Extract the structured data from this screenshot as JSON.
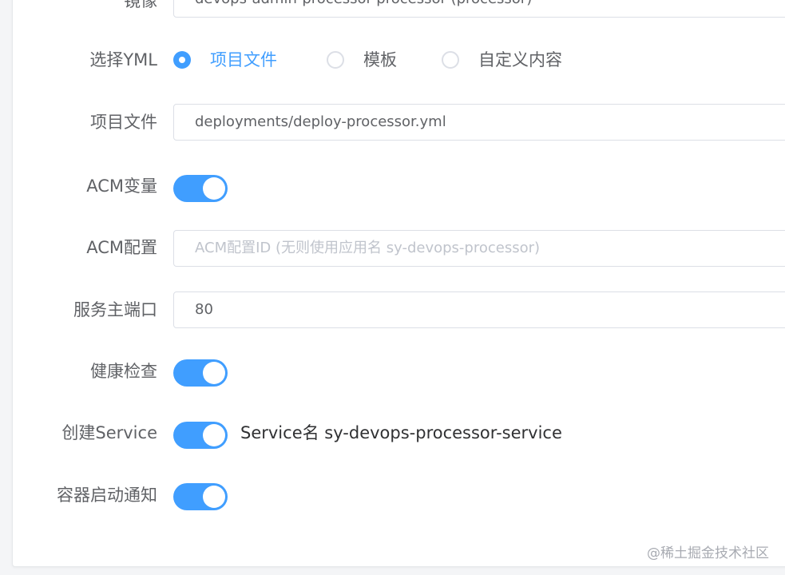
{
  "form": {
    "image": {
      "label": "镜像",
      "value": "devops-admin-processor-processor (processor)"
    },
    "yml": {
      "label": "选择YML",
      "options": [
        {
          "label": "项目文件",
          "checked": true
        },
        {
          "label": "模板",
          "checked": false
        },
        {
          "label": "自定义内容",
          "checked": false
        }
      ]
    },
    "project_file": {
      "label": "项目文件",
      "value": "deployments/deploy-processor.yml"
    },
    "acm_variable": {
      "label": "ACM变量",
      "on": true
    },
    "acm_config": {
      "label": "ACM配置",
      "value": "",
      "placeholder": "ACM配置ID (无则使用应用名 sy-devops-processor)"
    },
    "service_port": {
      "label": "服务主端口",
      "value": "80"
    },
    "health_check": {
      "label": "健康检查",
      "on": true
    },
    "create_service": {
      "label": "创建Service",
      "on": true,
      "service_name_text": "Service名 sy-devops-processor-service"
    },
    "startup_notify": {
      "label": "容器启动通知",
      "on": true
    }
  },
  "watermark": "@稀土掘金技术社区",
  "colors": {
    "accent": "#409eff",
    "text": "#606266",
    "border": "#dcdfe6",
    "placeholder": "#c0c4cc"
  }
}
